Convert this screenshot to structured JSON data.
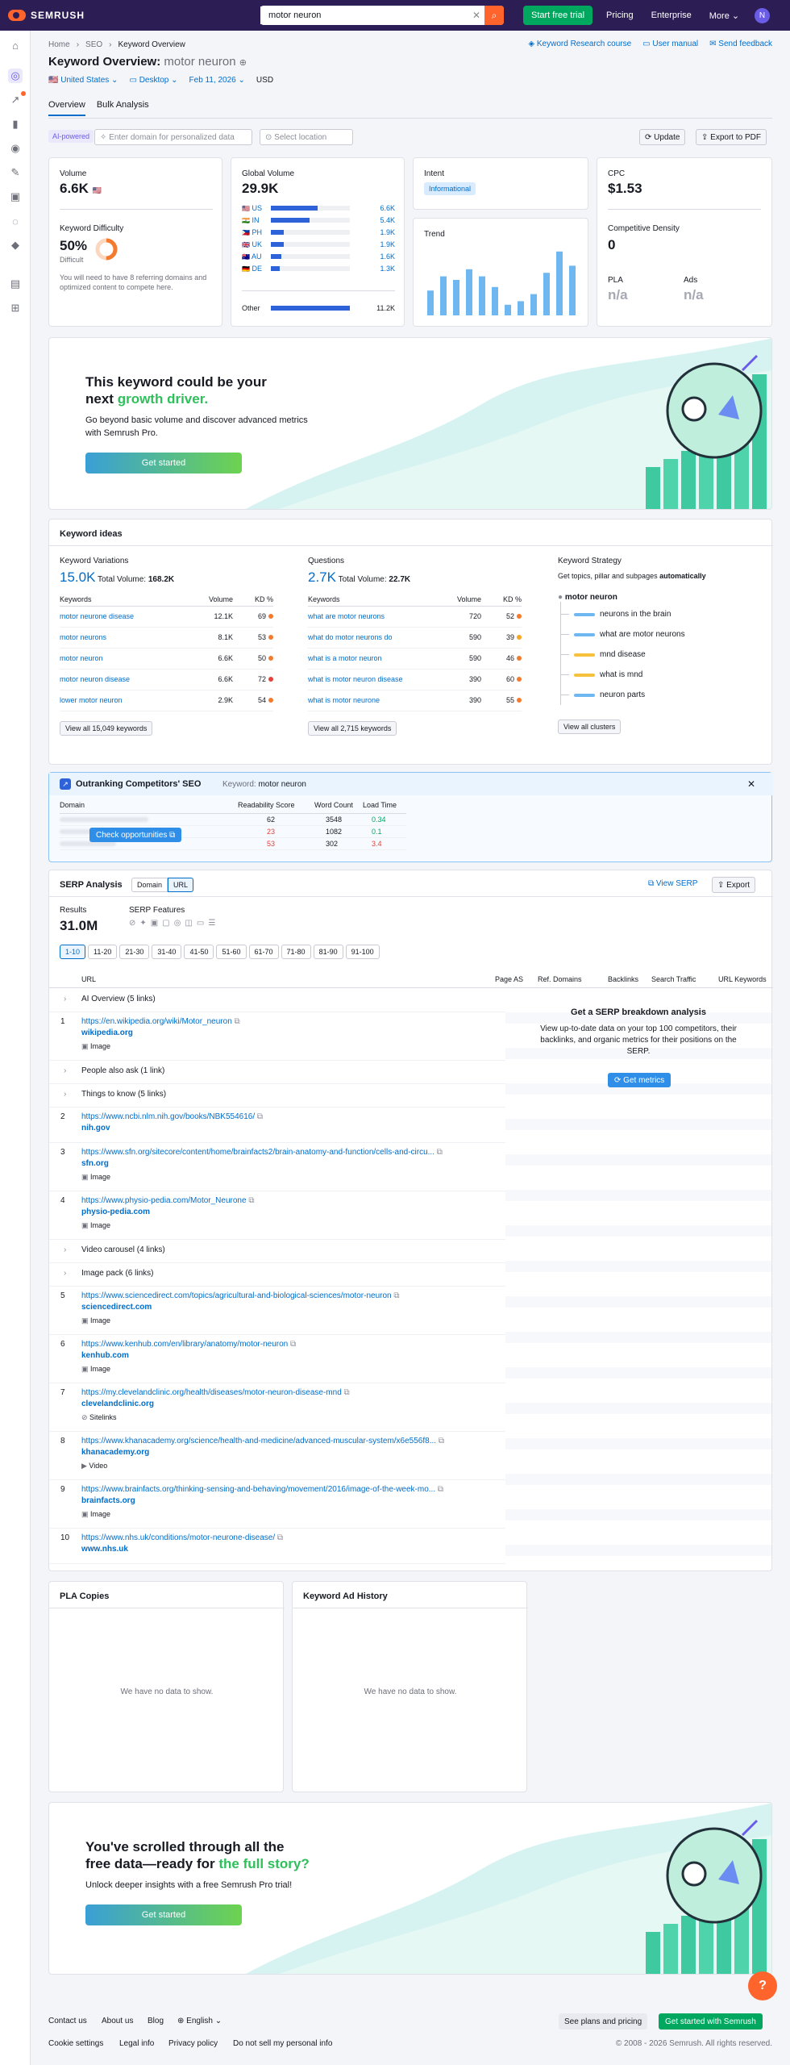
{
  "topbar": {
    "search_value": "motor neuron",
    "trial": "Start free trial",
    "nav": [
      "Pricing",
      "Enterprise",
      "More"
    ],
    "avatar": "N",
    "logo": "SEMRUSH"
  },
  "breadcrumb": [
    "Home",
    "SEO",
    "Keyword Overview"
  ],
  "toplinks": [
    "Keyword Research course",
    "User manual",
    "Send feedback"
  ],
  "title": {
    "label": "Keyword Overview:",
    "keyword": "motor neuron"
  },
  "filters": {
    "country": "United States",
    "device": "Desktop",
    "date": "Feb 11, 2026",
    "currency": "USD"
  },
  "tabs": [
    "Overview",
    "Bulk Analysis"
  ],
  "toolbar": {
    "ai_badge": "AI-powered",
    "domain_placeholder": "Enter domain for personalized data",
    "location_placeholder": "Select location",
    "update": "Update",
    "export": "Export to PDF"
  },
  "volume": {
    "label": "Volume",
    "value": "6.6K",
    "kd_label": "Keyword Difficulty",
    "kd_value": "50%",
    "kd_text": "Difficult",
    "kd_pct": 50,
    "kd_note": "You will need to have 8 referring domains and optimized content to compete here."
  },
  "global": {
    "label": "Global Volume",
    "value": "29.9K",
    "rows": [
      {
        "cc": "US",
        "v": "6.6K",
        "pct": 22
      },
      {
        "cc": "IN",
        "v": "5.4K",
        "pct": 18
      },
      {
        "cc": "PH",
        "v": "1.9K",
        "pct": 6
      },
      {
        "cc": "UK",
        "v": "1.9K",
        "pct": 6
      },
      {
        "cc": "AU",
        "v": "1.6K",
        "pct": 5
      },
      {
        "cc": "DE",
        "v": "1.3K",
        "pct": 4
      }
    ],
    "other_label": "Other",
    "other_value": "11.2K",
    "other_pct": 37
  },
  "intent": {
    "label": "Intent",
    "value": "Informational"
  },
  "trend": {
    "label": "Trend",
    "values": [
      0.35,
      0.55,
      0.5,
      0.65,
      0.55,
      0.4,
      0.15,
      0.2,
      0.3,
      0.6,
      0.9,
      0.7
    ]
  },
  "cpc": {
    "label": "CPC",
    "value": "$1.53",
    "cd_label": "Competitive Density",
    "cd_value": "0",
    "pla_label": "PLA",
    "pla_value": "n/a",
    "ads_label": "Ads",
    "ads_value": "n/a"
  },
  "promo1": {
    "line1": "This keyword could be your",
    "line2": "next ",
    "highlight": "growth driver.",
    "body": "Go beyond basic volume and discover advanced metrics with Semrush Pro.",
    "cta": "Get started"
  },
  "ideas": {
    "title": "Keyword ideas",
    "variations": {
      "label": "Keyword Variations",
      "count": "15.0K",
      "total_label": "Total Volume:",
      "total": "168.2K",
      "cols": [
        "Keywords",
        "Volume",
        "KD %"
      ],
      "rows": [
        [
          "motor neurone disease",
          "12.1K",
          "69",
          "#f27b2f"
        ],
        [
          "motor neurons",
          "8.1K",
          "53",
          "#f27b2f"
        ],
        [
          "motor neuron",
          "6.6K",
          "50",
          "#f27b2f"
        ],
        [
          "motor neuron disease",
          "6.6K",
          "72",
          "#e5403a"
        ],
        [
          "lower motor neuron",
          "2.9K",
          "54",
          "#f27b2f"
        ]
      ],
      "view_all": "View all 15,049 keywords"
    },
    "questions": {
      "label": "Questions",
      "count": "2.7K",
      "total_label": "Total Volume:",
      "total": "22.7K",
      "cols": [
        "Keywords",
        "Volume",
        "KD %"
      ],
      "rows": [
        [
          "what are motor neurons",
          "720",
          "52",
          "#f27b2f"
        ],
        [
          "what do motor neurons do",
          "590",
          "39",
          "#f6a623"
        ],
        [
          "what is a motor neuron",
          "590",
          "46",
          "#f27b2f"
        ],
        [
          "what is motor neuron disease",
          "390",
          "60",
          "#f27b2f"
        ],
        [
          "what is motor neurone",
          "390",
          "55",
          "#f27b2f"
        ]
      ],
      "view_all": "View all 2,715 keywords"
    },
    "strategy": {
      "label": "Keyword Strategy",
      "desc": "Get topics, pillar and subpages ",
      "desc_bold": "automatically",
      "root": "motor neuron",
      "items": [
        "neurons in the brain",
        "what are motor neurons",
        "mnd disease",
        "what is mnd",
        "neuron parts"
      ],
      "view_all": "View all clusters"
    }
  },
  "competitors": {
    "title": "Outranking Competitors' SEO",
    "kw_label": "Keyword:",
    "kw": "motor neuron",
    "cols": [
      "Domain",
      "Readability Score",
      "Word Count",
      "Load Time"
    ],
    "rows": [
      [
        "62",
        "3548",
        "0.34"
      ],
      [
        "23",
        "1082",
        "0.1"
      ],
      [
        "53",
        "302",
        "3.4"
      ]
    ],
    "cta": "Check opportunities"
  },
  "serp": {
    "title": "SERP Analysis",
    "toggle": [
      "Domain",
      "URL"
    ],
    "view": "View SERP",
    "export": "Export",
    "results_label": "Results",
    "results": "31.0M",
    "features_label": "SERP Features",
    "pages": [
      "1-10",
      "11-20",
      "21-30",
      "31-40",
      "41-50",
      "51-60",
      "61-70",
      "71-80",
      "81-90",
      "91-100"
    ],
    "cols": [
      "URL",
      "Page AS",
      "Ref. Domains",
      "Backlinks",
      "Search Traffic",
      "URL Keywords"
    ],
    "cta_title": "Get a SERP breakdown analysis",
    "cta_body": "View up-to-date data on your top 100 competitors, their backlinks, and organic metrics for their positions on the SERP.",
    "cta_btn": "Get metrics",
    "rows": [
      {
        "type": "feat",
        "text": "AI Overview (5 links)"
      },
      {
        "type": "res",
        "n": "1",
        "url": "https://en.wikipedia.org/wiki/Motor_neuron",
        "dom": "wikipedia.org",
        "feat": "Image"
      },
      {
        "type": "feat",
        "text": "People also ask (1 link)"
      },
      {
        "type": "feat",
        "text": "Things to know (5 links)"
      },
      {
        "type": "res",
        "n": "2",
        "url": "https://www.ncbi.nlm.nih.gov/books/NBK554616/",
        "dom": "nih.gov",
        "feat": ""
      },
      {
        "type": "res",
        "n": "3",
        "url": "https://www.sfn.org/sitecore/content/home/brainfacts2/brain-anatomy-and-function/cells-and-circu...",
        "dom": "sfn.org",
        "feat": "Image"
      },
      {
        "type": "res",
        "n": "4",
        "url": "https://www.physio-pedia.com/Motor_Neurone",
        "dom": "physio-pedia.com",
        "feat": "Image"
      },
      {
        "type": "feat",
        "text": "Video carousel (4 links)"
      },
      {
        "type": "feat",
        "text": "Image pack (6 links)"
      },
      {
        "type": "res",
        "n": "5",
        "url": "https://www.sciencedirect.com/topics/agricultural-and-biological-sciences/motor-neuron",
        "dom": "sciencedirect.com",
        "feat": "Image"
      },
      {
        "type": "res",
        "n": "6",
        "url": "https://www.kenhub.com/en/library/anatomy/motor-neuron",
        "dom": "kenhub.com",
        "feat": "Image"
      },
      {
        "type": "res",
        "n": "7",
        "url": "https://my.clevelandclinic.org/health/diseases/motor-neuron-disease-mnd",
        "dom": "clevelandclinic.org",
        "feat": "Sitelinks"
      },
      {
        "type": "res",
        "n": "8",
        "url": "https://www.khanacademy.org/science/health-and-medicine/advanced-muscular-system/x6e556f8...",
        "dom": "khanacademy.org",
        "feat": "Video"
      },
      {
        "type": "res",
        "n": "9",
        "url": "https://www.brainfacts.org/thinking-sensing-and-behaving/movement/2016/image-of-the-week-mo...",
        "dom": "brainfacts.org",
        "feat": "Image"
      },
      {
        "type": "res",
        "n": "10",
        "url": "https://www.nhs.uk/conditions/motor-neurone-disease/",
        "dom": "www.nhs.uk",
        "feat": ""
      }
    ]
  },
  "pla": {
    "title": "PLA Copies",
    "empty": "We have no data to show."
  },
  "adhist": {
    "title": "Keyword Ad History",
    "empty": "We have no data to show."
  },
  "promo2": {
    "line1": "You've scrolled through all the",
    "line2": "free data—ready for ",
    "highlight": "the full story?",
    "body": "Unlock deeper insights with a free Semrush Pro trial!",
    "cta": "Get started"
  },
  "footer": {
    "links": [
      "Contact us",
      "About us",
      "Blog",
      "English"
    ],
    "plans": "See plans and pricing",
    "start": "Get started with Semrush",
    "legal": [
      "Cookie settings",
      "Legal info",
      "Privacy policy",
      "Do not sell my personal info"
    ],
    "copyright": "© 2008 - 2026 Semrush. All rights reserved."
  },
  "help": "?"
}
